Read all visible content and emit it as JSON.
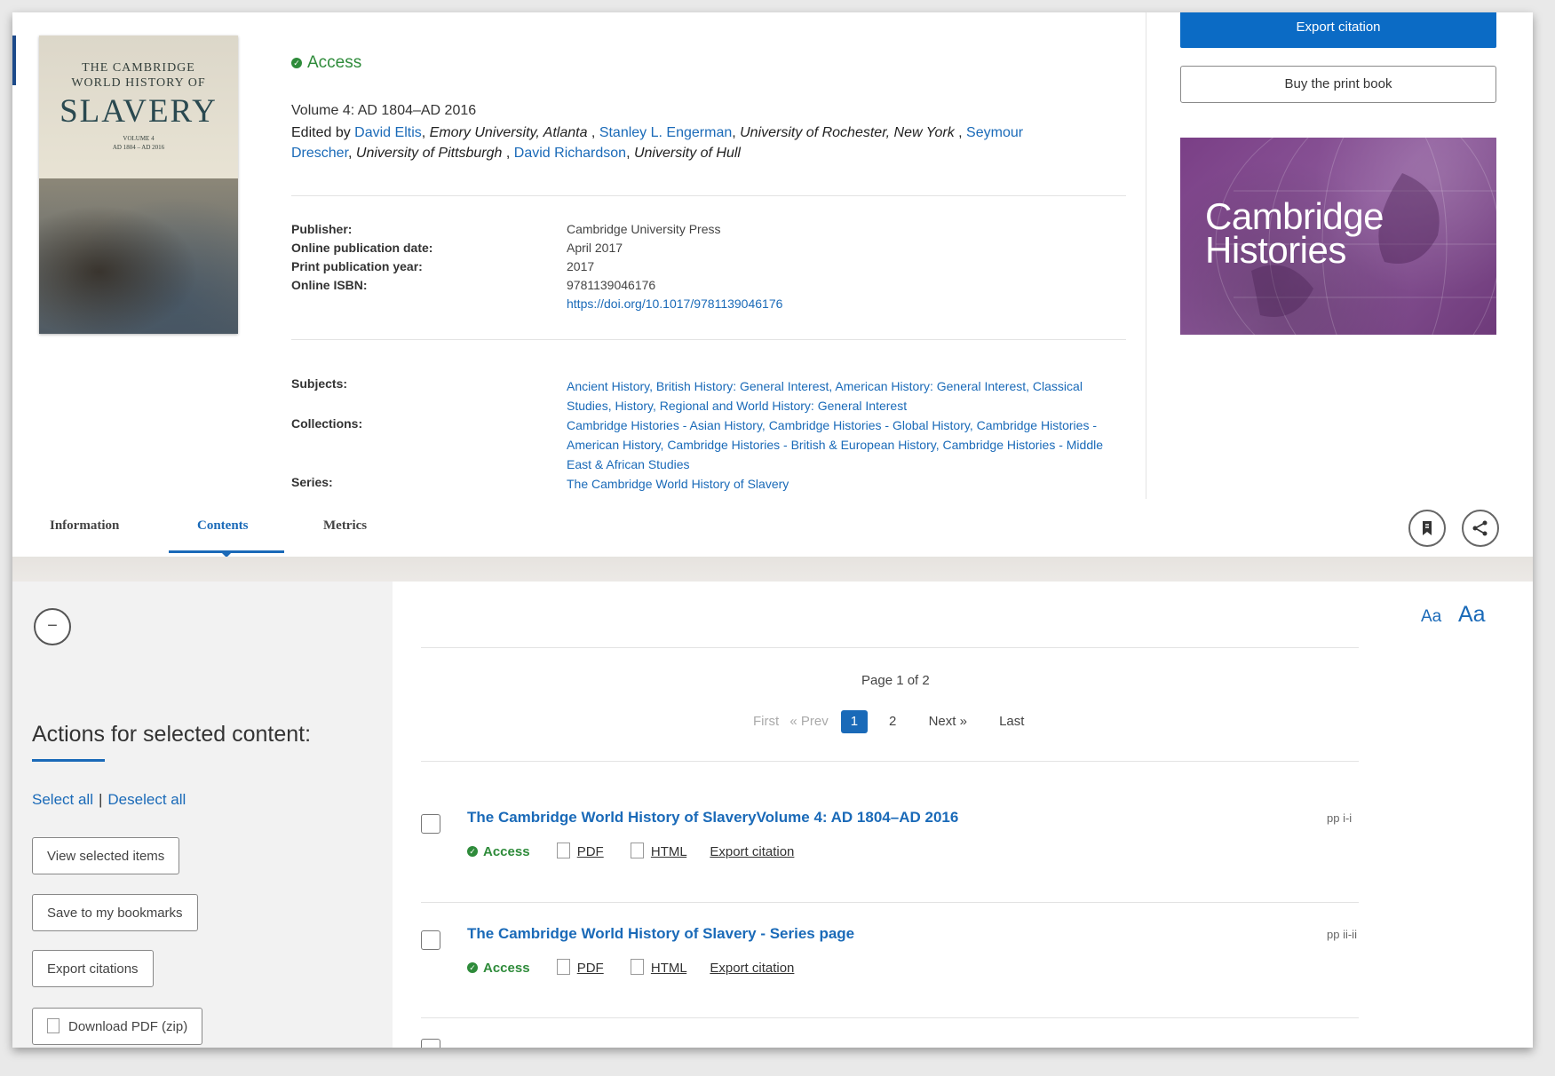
{
  "book": {
    "cover_line1": "THE CAMBRIDGE",
    "cover_line2": "WORLD HISTORY OF",
    "cover_title": "SLAVERY",
    "cover_volume": "VOLUME 4",
    "cover_dates": "AD 1804 – AD 2016",
    "access_label": "Access",
    "volume": "Volume 4: AD 1804–AD 2016",
    "edited_by": "Edited by",
    "editors": [
      {
        "name": "David Eltis",
        "affiliation": "Emory University, Atlanta"
      },
      {
        "name": "Stanley L. Engerman",
        "affiliation": "University of Rochester, New York"
      },
      {
        "name": "Seymour Drescher",
        "affiliation": "University of Pittsburgh"
      },
      {
        "name": "David Richardson",
        "affiliation": "University of Hull"
      }
    ]
  },
  "meta": {
    "publisher_label": "Publisher:",
    "publisher": "Cambridge University Press",
    "online_date_label": "Online publication date:",
    "online_date": "April 2017",
    "print_year_label": "Print publication year:",
    "print_year": "2017",
    "isbn_label": "Online ISBN:",
    "isbn": "9781139046176",
    "doi": "https://doi.org/10.1017/9781139046176",
    "subjects_label": "Subjects:",
    "subjects": "Ancient History, British History: General Interest, American History: General Interest, Classical Studies, History, Regional and World History: General Interest",
    "collections_label": "Collections:",
    "collections": "Cambridge Histories - Asian History, Cambridge Histories - Global History, Cambridge Histories - American History, Cambridge Histories - British & European History, Cambridge Histories - Middle East & African Studies",
    "series_label": "Series:",
    "series": "The Cambridge World History of Slavery"
  },
  "aside": {
    "export_citation": "Export citation",
    "buy_print": "Buy the print book",
    "promo_line1": "Cambridge",
    "promo_line2": "Histories"
  },
  "tabs": {
    "information": "Information",
    "contents": "Contents",
    "metrics": "Metrics",
    "active": "Contents"
  },
  "sidebar": {
    "collapse_symbol": "−",
    "actions_title": "Actions for selected content:",
    "select_all": "Select all",
    "separator": "|",
    "deselect_all": "Deselect all",
    "buttons": [
      "View selected items",
      "Save to my bookmarks",
      "Export citations",
      "Download PDF (zip)"
    ]
  },
  "contents": {
    "aa_small": "Aa",
    "aa_big": "Aa",
    "page_info": "Page 1 of 2",
    "pager": {
      "first": "First",
      "prev": "« Prev",
      "current": "1",
      "page2": "2",
      "next": "Next »",
      "last": "Last"
    },
    "items": [
      {
        "title": "The Cambridge World History of SlaveryVolume 4: AD 1804–AD 2016",
        "access": "Access",
        "pdf": "PDF",
        "html": "HTML",
        "export": "Export citation",
        "pages": "pp i-i"
      },
      {
        "title": "The Cambridge World History of Slavery - Series page",
        "access": "Access",
        "pdf": "PDF",
        "html": "HTML",
        "export": "Export citation",
        "pages": "pp ii-ii"
      }
    ]
  }
}
